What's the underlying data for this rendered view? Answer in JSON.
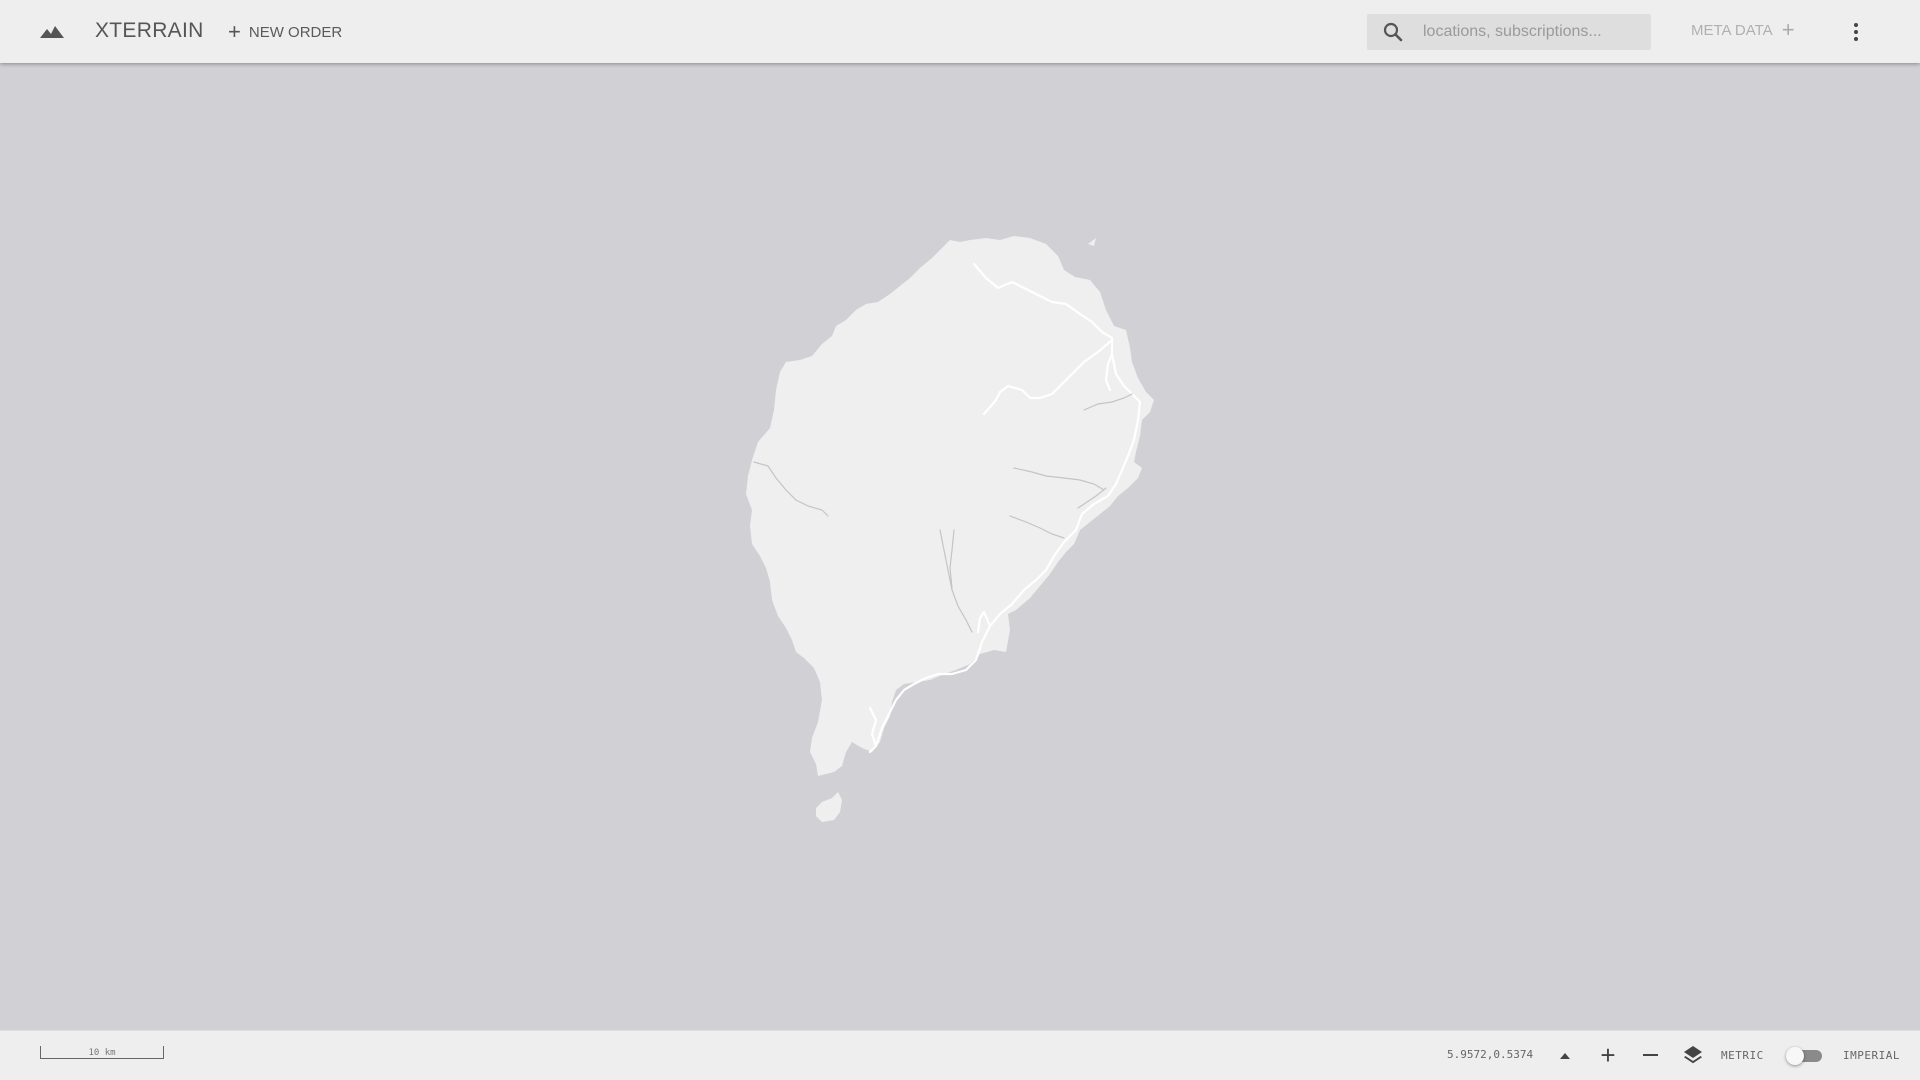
{
  "app": {
    "title": "XTERRAIN",
    "logo_icon": "mountain-icon"
  },
  "toolbar": {
    "new_order_label": "NEW ORDER",
    "meta_data_label": "META DATA",
    "search_placeholder": "locations, subscriptions...",
    "search_value": ""
  },
  "map": {
    "land_color": "#efefef",
    "water_color": "#d1d0d5",
    "road_color": "#ffffff",
    "river_color": "#c4c4c8"
  },
  "statusbar": {
    "scale_label": "10 km",
    "coordinates": "5.9572,0.5374",
    "unit_metric": "METRIC",
    "unit_imperial": "IMPERIAL",
    "unit_imperial_selected": true
  }
}
